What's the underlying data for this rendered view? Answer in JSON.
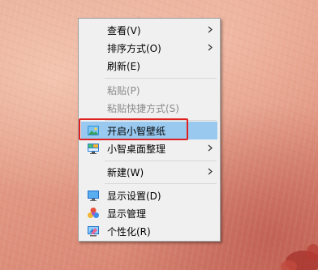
{
  "context_menu": {
    "items": [
      {
        "label": "查看(V)",
        "has_submenu": true
      },
      {
        "label": "排序方式(O)",
        "has_submenu": true
      },
      {
        "label": "刷新(E)"
      },
      {
        "label": "粘贴(P)",
        "disabled": true
      },
      {
        "label": "粘贴快捷方式(S)",
        "disabled": true
      },
      {
        "label": "开启小智壁纸",
        "icon": "wallpaper-icon",
        "highlighted": true
      },
      {
        "label": "小智桌面整理",
        "icon": "desktop-organizer-icon",
        "has_submenu": true
      },
      {
        "label": "新建(W)",
        "has_submenu": true
      },
      {
        "label": "显示设置(D)",
        "icon": "display-settings-icon"
      },
      {
        "label": "显示管理",
        "icon": "display-manager-icon"
      },
      {
        "label": "个性化(R)",
        "icon": "personalize-icon"
      }
    ]
  },
  "colors": {
    "highlight": "#99c9ef",
    "annotation_box": "#e02020",
    "menu_background": "#f0f0f0"
  }
}
